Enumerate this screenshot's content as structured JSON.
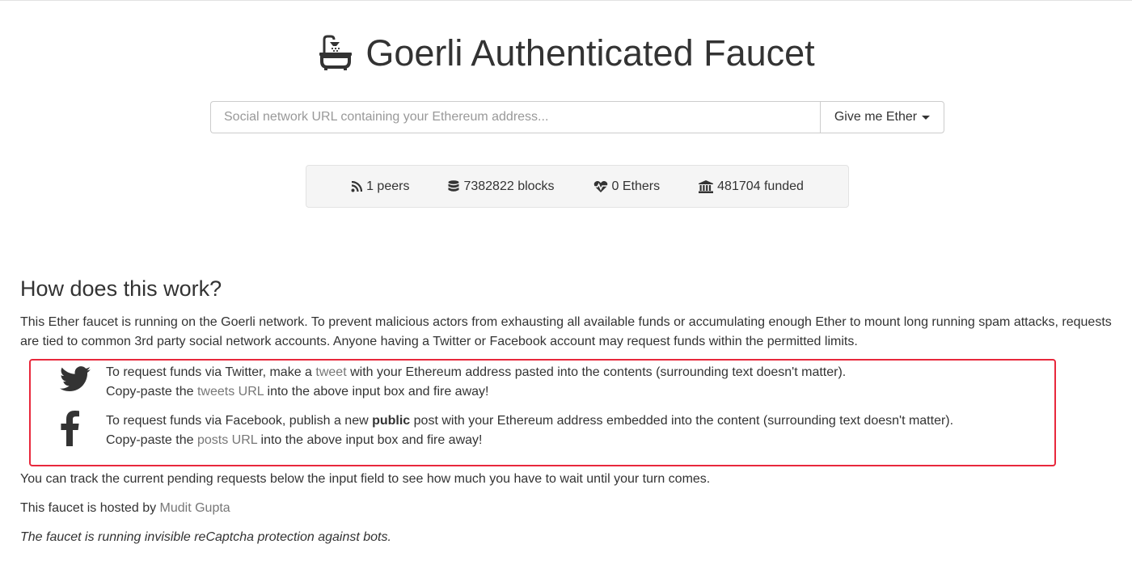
{
  "app": {
    "title": "Goerli Authenticated Faucet",
    "title_icon": "bath-icon"
  },
  "request_form": {
    "placeholder": "Social network URL containing your Ethereum address...",
    "value": "",
    "button_label": "Give me Ether"
  },
  "stats": {
    "peers": "1 peers",
    "blocks": "7382822 blocks",
    "ethers": "0 Ethers",
    "funded": "481704 funded"
  },
  "info": {
    "heading": "How does this work?",
    "intro": "This Ether faucet is running on the Goerli network. To prevent malicious actors from exhausting all available funds or accumulating enough Ether to mount long running spam attacks, requests are tied to common 3rd party social network accounts. Anyone having a Twitter or Facebook account may request funds within the permitted limits.",
    "twitter": {
      "icon": "twitter-icon",
      "line1_pre": "To request funds via Twitter, make a ",
      "line1_link": "tweet",
      "line1_post": " with your Ethereum address pasted into the contents (surrounding text doesn't matter).",
      "line2_pre": "Copy-paste the ",
      "line2_link": "tweets URL",
      "line2_post": " into the above input box and fire away!"
    },
    "facebook": {
      "icon": "facebook-icon",
      "line1_pre": "To request funds via Facebook, publish a new ",
      "line1_bold": "public",
      "line1_post": " post with your Ethereum address embedded into the content (surrounding text doesn't matter).",
      "line2_pre": "Copy-paste the ",
      "line2_link": "posts URL",
      "line2_post": " into the above input box and fire away!"
    },
    "track": "You can track the current pending requests below the input field to see how much you have to wait until your turn comes.",
    "hosted_pre": "This faucet is hosted by ",
    "hosted_link": "Mudit Gupta",
    "captcha": "The faucet is running invisible reCaptcha protection against bots."
  },
  "colors": {
    "highlight_border": "#e8283c",
    "link": "#777777",
    "stats_bg": "#f5f5f5"
  }
}
